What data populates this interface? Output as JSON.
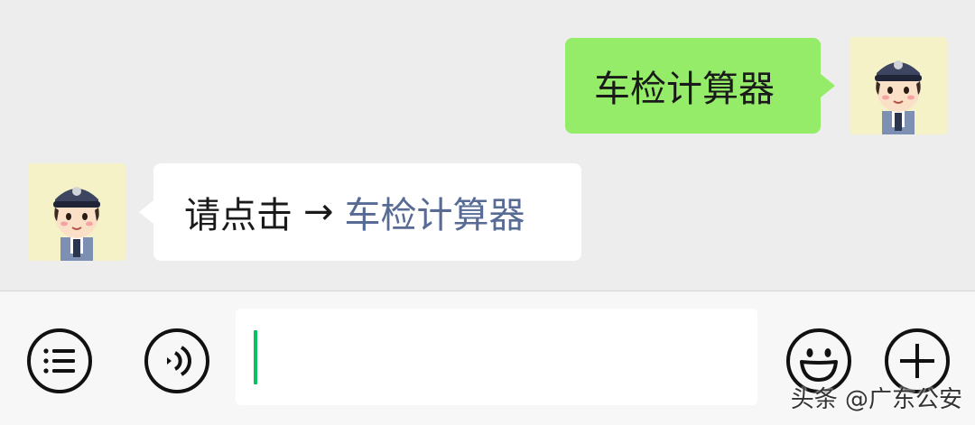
{
  "chat": {
    "sent_message": "车检计算器",
    "reply": {
      "prefix": "请点击",
      "arrow": "→",
      "link_text": "车检计算器"
    }
  },
  "input_bar": {
    "menu_icon": "list-menu-icon",
    "voice_icon": "voice-icon",
    "emoji_icon": "emoji-icon",
    "plus_icon": "plus-icon",
    "text_value": ""
  },
  "watermark": "头条 @广东公安",
  "colors": {
    "chat_background": "#ededed",
    "sent_bubble": "#95ec69",
    "received_bubble": "#ffffff",
    "link": "#576b95",
    "caret": "#07c160",
    "input_bar": "#f7f7f7"
  }
}
